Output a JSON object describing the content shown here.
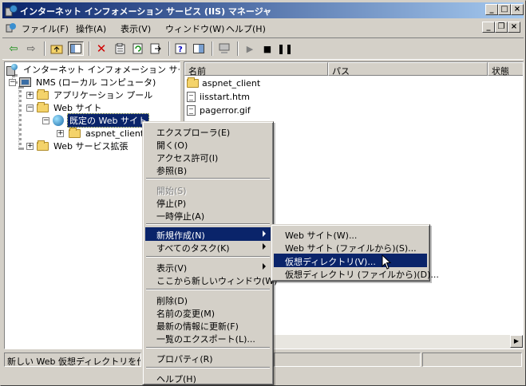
{
  "window": {
    "title": "インターネット インフォメーション サービス (IIS) マネージャ",
    "minimize": "_",
    "maximize": "□",
    "close": "×"
  },
  "menubar": {
    "items": [
      "ファイル(F)",
      "操作(A)",
      "表示(V)",
      "ウィンドウ(W)",
      "ヘルプ(H)"
    ],
    "mdi_minimize": "_",
    "mdi_restore": "❐",
    "mdi_close": "×"
  },
  "toolbar": {
    "icons": [
      "back-arrow-icon",
      "forward-arrow-icon",
      "up-folder-icon",
      "show-hide-tree-icon",
      "delete-icon",
      "properties-icon",
      "refresh-icon",
      "export-icon",
      "help-icon",
      "show-hide-pane-icon",
      "computer-icon",
      "play-icon",
      "stop-icon",
      "pause-icon"
    ]
  },
  "tree": {
    "root": "インターネット インフォメーション サービス",
    "computer": "NMS (ローカル コンピュータ)",
    "app_pools": "アプリケーション プール",
    "websites": "Web サイト",
    "default_site": "既定の Web サイト",
    "aspnet_client": "aspnet_client",
    "web_ext": "Web サービス拡張"
  },
  "list": {
    "columns": [
      "名前",
      "パス",
      "状態"
    ],
    "rows": [
      "aspnet_client",
      "iisstart.htm",
      "pagerror.gif"
    ]
  },
  "status": {
    "text": "新しい Web 仮想ディレクトリを作成します。"
  },
  "context_menu": {
    "items": [
      "エクスプローラ(E)",
      "開く(O)",
      "アクセス許可(I)",
      "参照(B)",
      "開始(S)",
      "停止(P)",
      "一時停止(A)",
      "新規作成(N)",
      "すべてのタスク(K)",
      "表示(V)",
      "ここから新しいウィンドウ(W)",
      "削除(D)",
      "名前の変更(M)",
      "最新の情報に更新(F)",
      "一覧のエクスポート(L)...",
      "プロパティ(R)",
      "ヘルプ(H)"
    ]
  },
  "submenu": {
    "items": [
      "Web サイト(W)...",
      "Web サイト (ファイルから)(S)...",
      "仮想ディレクトリ(V)...",
      "仮想ディレクトリ (ファイルから)(D)..."
    ]
  },
  "colors": {
    "highlight": "#0a246a",
    "face": "#d4d0c8"
  }
}
